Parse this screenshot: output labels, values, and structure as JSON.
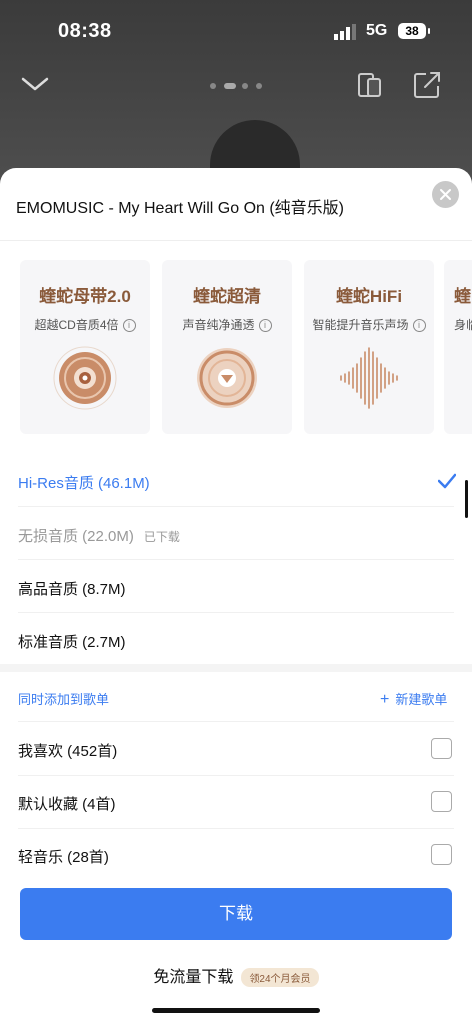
{
  "status": {
    "time": "08:38",
    "network": "5G",
    "battery": "38"
  },
  "colors": {
    "accent": "#3b7cf0",
    "brown": "#8a5a3a"
  },
  "sheet": {
    "title": "EMOMUSIC - My Heart Will Go On (纯音乐版)",
    "close_icon": "close-icon"
  },
  "cards": [
    {
      "title": "蝰蛇母带2.0",
      "sub": "超越CD音质4倍",
      "icon": "disc-icon"
    },
    {
      "title": "蝰蛇超清",
      "sub": "声音纯净通透",
      "icon": "vinyl-icon"
    },
    {
      "title": "蝰蛇HiFi",
      "sub": "智能提升音乐声场",
      "icon": "waveform-icon"
    },
    {
      "title": "蝰",
      "sub": "身临",
      "icon": "partial-icon"
    }
  ],
  "qualities": [
    {
      "label": "Hi-Res音质 (46.1M)",
      "selected": true
    },
    {
      "label": "无损音质 (22.0M)",
      "tag": "已下载"
    },
    {
      "label": "高品音质 (8.7M)"
    },
    {
      "label": "标准音质 (2.7M)"
    }
  ],
  "playlist": {
    "header": "同时添加到歌单",
    "new_label": "新建歌单",
    "items": [
      {
        "label": "我喜欢 (452首)"
      },
      {
        "label": "默认收藏 (4首)"
      },
      {
        "label": "轻音乐 (28首)"
      }
    ]
  },
  "download_button": "下载",
  "free_download": {
    "label": "免流量下载",
    "badge": "领24个月会员"
  }
}
